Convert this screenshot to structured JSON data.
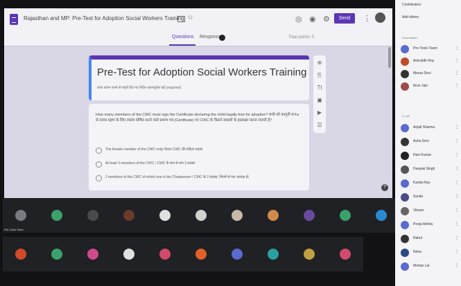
{
  "form": {
    "window_title": "Rajasthan and MP: Pre-Test for Adoption Social Workers Training",
    "send_label": "Send",
    "tabs": [
      "Questions",
      "Responses",
      "Total points: 0"
    ],
    "heading": "Pre-Test for Adoption Social Workers Training",
    "description": "प्रपत्र प्रारंभ करने से पहले दिए गए निर्देश ध्यानपूर्वक पढ़ें (required)",
    "question": "How many members of the CWC must sign the Certificate declaring the child legally free for adoption? बच्चे को कानूनी रूप से दत्तक ग्रहण के लिए स्वतंत्र घोषित करने वाले प्रमाण पत्र (Certificate) पर CWC के कितने सदस्यों के हस्ताक्षर करना जरूरी है?",
    "options": [
      "The female member of the CWC only/ केवल CWC की महिला सदस्य",
      "At least 3 members of the CWC / CWC के कम से कम 3 सदस्य",
      "2 members of the CWC of which one is the Chairperson / CWC के 2 सदस्य, जिनमें से एक अध्यक्ष हो"
    ]
  },
  "tiles": [
    {
      "name": "Pre-Tests Team",
      "color": "#7a7a80"
    },
    {
      "name": "",
      "color": "#3aa16a"
    },
    {
      "name": "",
      "color": "#4a4a4e"
    },
    {
      "name": "",
      "color": "#6a3a2a"
    },
    {
      "name": "",
      "color": "#e0e0e0"
    },
    {
      "name": "",
      "color": "#d0d0d0"
    },
    {
      "name": "",
      "color": "#c8b8a8"
    },
    {
      "name": "",
      "color": "#d08a4a"
    },
    {
      "name": "",
      "color": "#6a4aa0"
    },
    {
      "name": "",
      "color": "#3aa16a"
    },
    {
      "name": "",
      "color": "#2a8ad0"
    },
    {
      "name": "",
      "color": "#d04a2a"
    },
    {
      "name": "",
      "color": "#3aa16a"
    },
    {
      "name": "",
      "color": "#d04a8a"
    },
    {
      "name": "",
      "color": "#e0e0e0"
    },
    {
      "name": "",
      "color": "#d04a6a"
    },
    {
      "name": "",
      "color": "#e0602a"
    },
    {
      "name": "",
      "color": "#5a6ad0"
    },
    {
      "name": "",
      "color": "#2aa0a0"
    },
    {
      "name": "",
      "color": "#c0a040"
    },
    {
      "name": "",
      "color": "#d04a6a"
    }
  ],
  "panel": {
    "header": "Contributors",
    "sub": "Add others",
    "sections": [
      "Presentation",
      "In call"
    ],
    "participants": [
      {
        "name": "Pre-Tests Team",
        "color": "#5a6ad0"
      },
      {
        "name": "Aniruddh Roy",
        "color": "#c04a2a"
      },
      {
        "name": "Meera Devi",
        "color": "#333"
      },
      {
        "name": "Arun Jain",
        "color": "#a04a4a"
      },
      {
        "name": "Anjali Sharma",
        "color": "#5a6ad0"
      },
      {
        "name": "Asha Devi",
        "color": "#333"
      },
      {
        "name": "Ravi Kumar",
        "color": "#222"
      },
      {
        "name": "Deepak Singh",
        "color": "#555"
      },
      {
        "name": "Kavita Rao",
        "color": "#5a6ad0"
      },
      {
        "name": "Sunita",
        "color": "#4a4a8a"
      },
      {
        "name": "Vikram",
        "color": "#666"
      },
      {
        "name": "Pooja Mehta",
        "color": "#5a6ad0"
      },
      {
        "name": "Rahul",
        "color": "#333"
      },
      {
        "name": "Neha",
        "color": "#2a4a8a"
      },
      {
        "name": "Mohan Lal",
        "color": "#5a6ad0"
      }
    ]
  }
}
